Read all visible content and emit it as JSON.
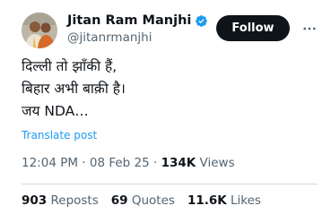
{
  "author": {
    "name": "Jitan Ram Manjhi",
    "handle": "@jitanrmanjhi"
  },
  "follow_label": "Follow",
  "tweet": {
    "text": "दिल्ली तो झाँकी हैं,\nबिहार अभी बाक़ी है।\nजय NDA…"
  },
  "translate_label": "Translate post",
  "meta": {
    "time": "12:04 PM",
    "separator1": " · ",
    "date": "08 Feb 25",
    "separator2": " · ",
    "views_count": "134K",
    "views_label": "Views"
  },
  "stats": {
    "reposts_count": "903",
    "reposts_label": "Reposts",
    "quotes_count": "69",
    "quotes_label": "Quotes",
    "likes_count": "11.6K",
    "likes_label": "Likes"
  },
  "colors": {
    "accent": "#1d9bf0",
    "text": "#0f1419",
    "secondary": "#536471"
  },
  "icons": [
    "verified-badge-icon",
    "more-options-icon"
  ]
}
